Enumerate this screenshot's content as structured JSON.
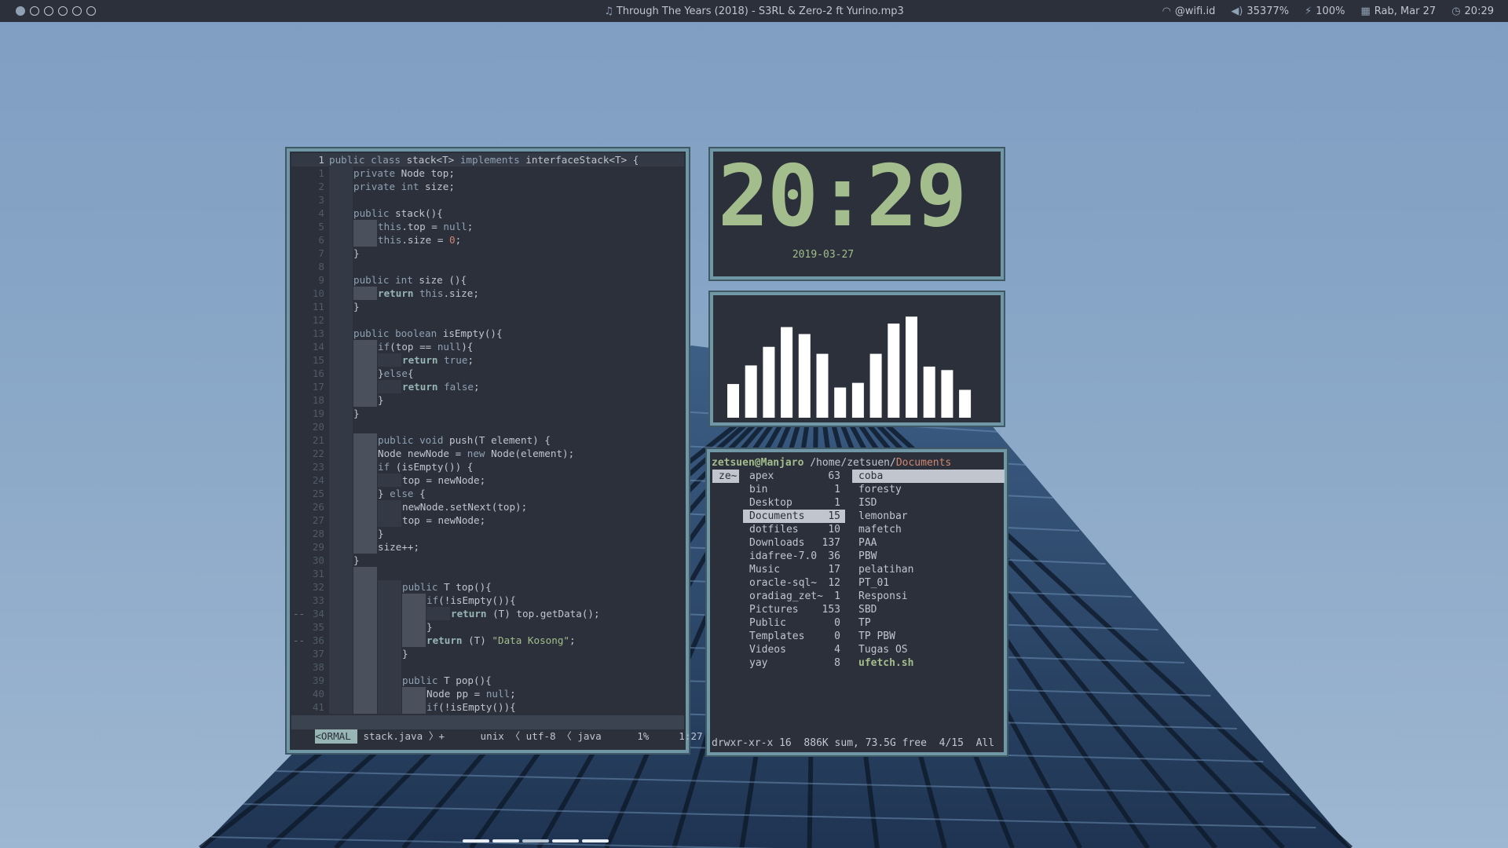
{
  "topbar": {
    "workspaces": [
      true,
      false,
      false,
      false,
      false,
      false
    ],
    "now_playing": "Through The Years (2018) - S3RL & Zero-2 ft Yurino.mp3",
    "wifi": "@wifi.id",
    "volume": "35377%",
    "battery": "100%",
    "date": "Rab, Mar 27",
    "time": "20:29"
  },
  "editor": {
    "lines": [
      {
        "n": "1",
        "cur": true,
        "i": 0,
        "t": "<span class=kw>public</span> <span class=kw>class</span> stack&lt;T&gt; <span class=kw>implements</span> interfaceStack&lt;T&gt; {"
      },
      {
        "n": "1",
        "i": 1,
        "t": "<span class=kw>private</span> Node top;"
      },
      {
        "n": "2",
        "i": 1,
        "t": "<span class=kw>private</span> <span class=kw>int</span> size;"
      },
      {
        "n": "3",
        "i": 1,
        "t": ""
      },
      {
        "n": "4",
        "i": 1,
        "t": "<span class=kw>public</span> stack(){"
      },
      {
        "n": "5",
        "i": 2,
        "t": "<span class=kw>this</span>.top = <span class=kw>null</span>;"
      },
      {
        "n": "6",
        "i": 2,
        "t": "<span class=kw>this</span>.size = <span class=num-lit>0</span>;"
      },
      {
        "n": "7",
        "i": 1,
        "t": "}"
      },
      {
        "n": "8",
        "i": 1,
        "t": ""
      },
      {
        "n": "9",
        "i": 1,
        "t": "<span class=kw>public</span> <span class=kw>int</span> size (){"
      },
      {
        "n": "10",
        "i": 2,
        "t": "<span class=kwb>return</span> <span class=kw>this</span>.size;"
      },
      {
        "n": "11",
        "i": 1,
        "t": "}"
      },
      {
        "n": "12",
        "i": 1,
        "t": ""
      },
      {
        "n": "13",
        "i": 1,
        "t": "<span class=kw>public</span> <span class=kw>boolean</span> isEmpty(){"
      },
      {
        "n": "14",
        "i": 2,
        "t": "<span class=kw>if</span>(top == <span class=kw>null</span>){"
      },
      {
        "n": "15",
        "i": 3,
        "t": "<span class=kwb>return</span> <span class=kw>true</span>;"
      },
      {
        "n": "16",
        "i": 2,
        "t": "}<span class=kw>else</span>{"
      },
      {
        "n": "17",
        "i": 3,
        "t": "<span class=kwb>return</span> <span class=kw>false</span>;"
      },
      {
        "n": "18",
        "i": 2,
        "t": "}"
      },
      {
        "n": "19",
        "i": 1,
        "t": "}"
      },
      {
        "n": "20",
        "i": 1,
        "t": ""
      },
      {
        "n": "21",
        "i": 2,
        "t": "<span class=kw>public</span> <span class=kw>void</span> push(T element) {"
      },
      {
        "n": "22",
        "i": 2,
        "t": "Node newNode = <span class=kw>new</span> Node(element);"
      },
      {
        "n": "23",
        "i": 2,
        "t": "<span class=kw>if</span> (isEmpty()) {"
      },
      {
        "n": "24",
        "i": 3,
        "t": "top = newNode;"
      },
      {
        "n": "25",
        "i": 2,
        "t": "} <span class=kw>else</span> {"
      },
      {
        "n": "26",
        "i": 3,
        "t": "newNode.setNext(top);"
      },
      {
        "n": "27",
        "i": 3,
        "t": "top = newNode;"
      },
      {
        "n": "28",
        "i": 2,
        "t": "}"
      },
      {
        "n": "29",
        "i": 2,
        "t": "size++;"
      },
      {
        "n": "30",
        "i": 1,
        "t": "}"
      },
      {
        "n": "31",
        "i": 2,
        "t": ""
      },
      {
        "n": "32",
        "i": 3,
        "t": "<span class=kw>public</span> T top(){"
      },
      {
        "n": "33",
        "i": 4,
        "t": "<span class=kw>if</span>(!isEmpty()){"
      },
      {
        "n": "34",
        "m": "--",
        "i": 5,
        "t": "<span class=kwb>return</span> (T) top.getData();"
      },
      {
        "n": "35",
        "i": 4,
        "t": "}"
      },
      {
        "n": "36",
        "m": "--",
        "i": 4,
        "t": "<span class=kwb>return</span> (T) <span class=str>\"Data Kosong\"</span>;"
      },
      {
        "n": "37",
        "i": 3,
        "t": "}"
      },
      {
        "n": "38",
        "i": 3,
        "t": ""
      },
      {
        "n": "39",
        "i": 3,
        "t": "<span class=kw>public</span> T pop(){"
      },
      {
        "n": "40",
        "i": 4,
        "t": "Node pp = <span class=kw>null</span>;"
      },
      {
        "n": "41",
        "i": 4,
        "t": "<span class=kw>if</span>(!isEmpty()){"
      }
    ],
    "statusline": {
      "mode": "<ORMAL",
      "file": "stack.java",
      "modified": "+",
      "fileformat": "unix",
      "encoding": "utf-8",
      "filetype": "java",
      "percent": "1%",
      "position": "1:27"
    }
  },
  "clock": {
    "time": "20:29",
    "date": "2019-03-27"
  },
  "visualizer": {
    "levels": [
      0.29,
      0.45,
      0.61,
      0.78,
      0.72,
      0.55,
      0.26,
      0.3,
      0.55,
      0.81,
      0.87,
      0.44,
      0.41,
      0.24
    ],
    "color": "#ffffff"
  },
  "file_manager": {
    "user": "zetsuen@Manjaro",
    "path_prefix": "/home/zetsuen/",
    "path_highlight": "Documents",
    "parent": [
      "ze~"
    ],
    "current": [
      {
        "name": "apex",
        "count": "63"
      },
      {
        "name": "bin",
        "count": "1"
      },
      {
        "name": "Desktop",
        "count": "1"
      },
      {
        "name": "Documents",
        "count": "15",
        "sel": true
      },
      {
        "name": "dotfiles",
        "count": "10"
      },
      {
        "name": "Downloads",
        "count": "137"
      },
      {
        "name": "idafree-7.0",
        "count": "36"
      },
      {
        "name": "Music",
        "count": "17"
      },
      {
        "name": "oracle-sql~",
        "count": "12"
      },
      {
        "name": "oradiag_zet~",
        "count": "1"
      },
      {
        "name": "Pictures",
        "count": "153"
      },
      {
        "name": "Public",
        "count": "0"
      },
      {
        "name": "Templates",
        "count": "0"
      },
      {
        "name": "Videos",
        "count": "4"
      },
      {
        "name": "yay",
        "count": "8"
      }
    ],
    "preview": [
      {
        "name": "coba",
        "sel": true
      },
      {
        "name": "foresty"
      },
      {
        "name": "ISD"
      },
      {
        "name": "lemonbar"
      },
      {
        "name": "mafetch"
      },
      {
        "name": "PAA"
      },
      {
        "name": "PBW"
      },
      {
        "name": "pelatihan"
      },
      {
        "name": "PT_01"
      },
      {
        "name": "Responsi"
      },
      {
        "name": "SBD"
      },
      {
        "name": "TP"
      },
      {
        "name": "TP PBW"
      },
      {
        "name": "Tugas OS"
      },
      {
        "name": "ufetch.sh",
        "exec": true
      }
    ],
    "footer": {
      "perms": "drwxr-xr-x",
      "links": "16",
      "summary": "886K sum, 73.5G free",
      "position": "4/15",
      "scroll": "All"
    }
  },
  "bottom_indicator": [
    false,
    false,
    true,
    false,
    false
  ]
}
